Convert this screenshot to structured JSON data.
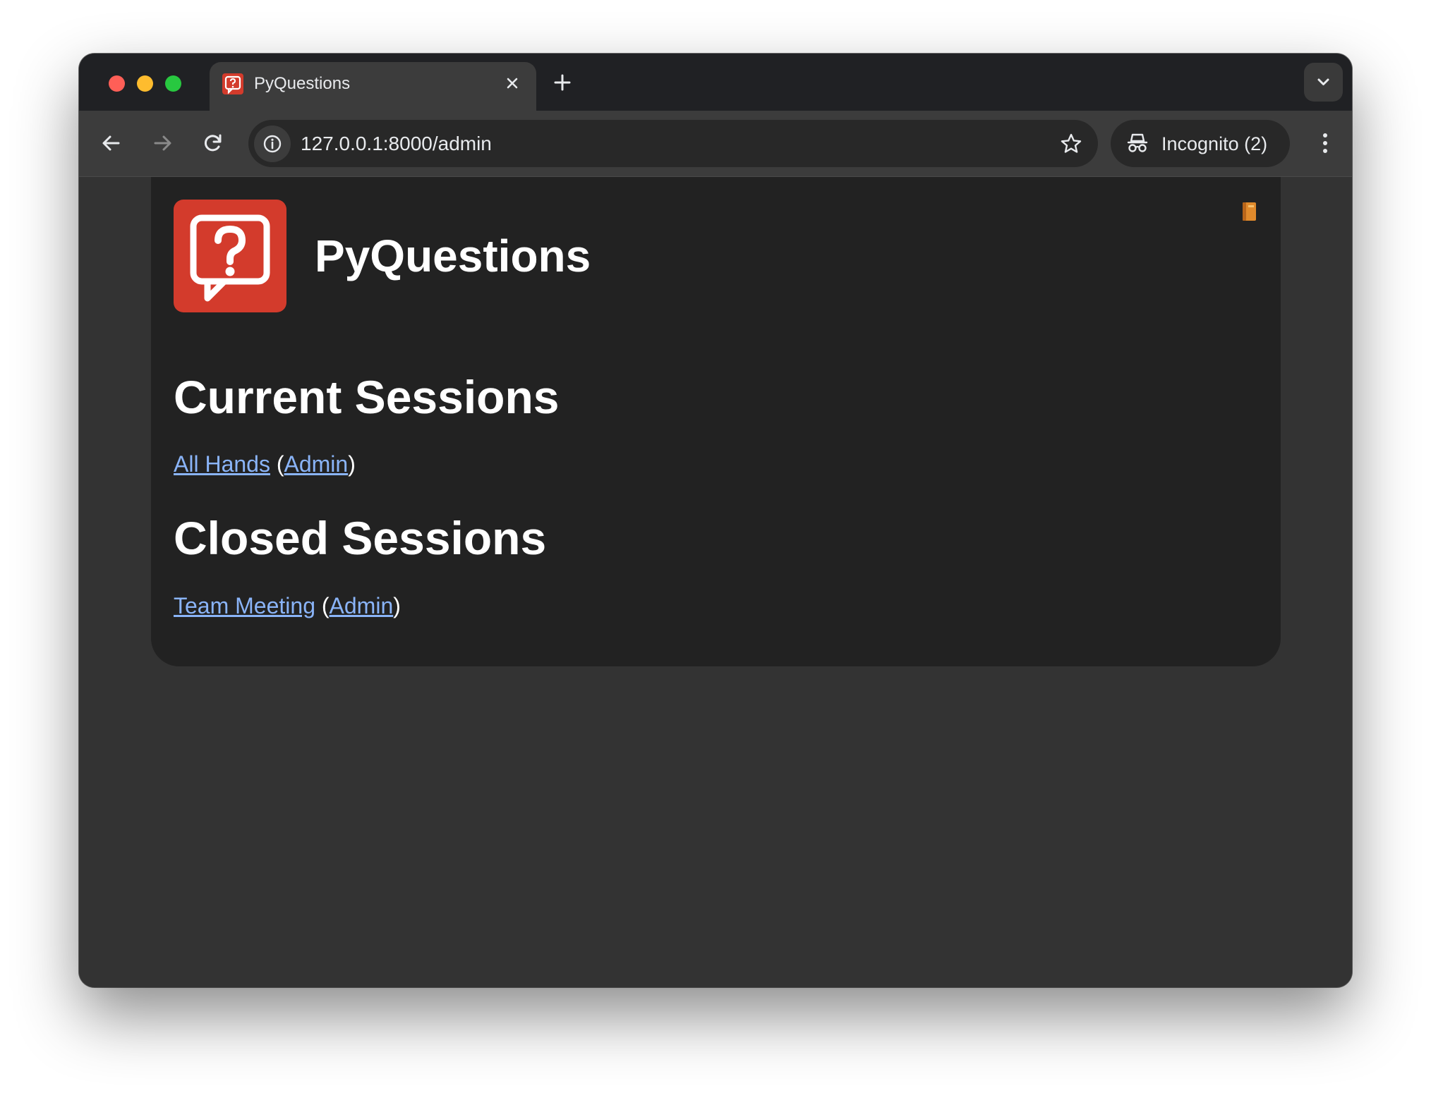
{
  "browser": {
    "tab": {
      "title": "PyQuestions"
    },
    "address_bar": {
      "url": "127.0.0.1:8000/admin"
    },
    "profile": {
      "label": "Incognito (2)"
    }
  },
  "page": {
    "brand": "PyQuestions",
    "sections": {
      "current": {
        "heading": "Current Sessions",
        "items": [
          {
            "name": "All Hands",
            "open_paren": "(",
            "admin_label": "Admin",
            "close_paren": ")"
          }
        ]
      },
      "closed": {
        "heading": "Closed Sessions",
        "items": [
          {
            "name": "Team Meeting",
            "open_paren": "(",
            "admin_label": "Admin",
            "close_paren": ")"
          }
        ]
      }
    }
  },
  "icons": {
    "logo": "question-speech-bubble-icon",
    "top_right": "book-icon"
  },
  "colors": {
    "brand_red": "#d33b2c",
    "link": "#8ab4f8",
    "card_bg": "#222222",
    "page_bg": "#333333"
  }
}
